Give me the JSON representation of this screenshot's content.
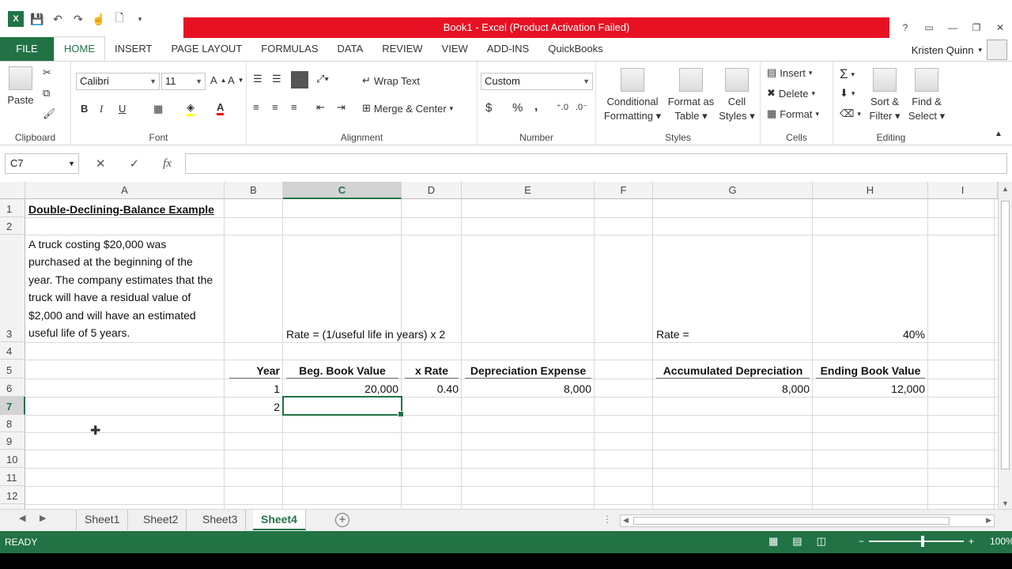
{
  "app": {
    "title": "Book1 -  Excel (Product Activation Failed)",
    "logo": "X",
    "help": "?",
    "window_controls": [
      "▭",
      "—",
      "❐",
      "✕"
    ]
  },
  "tabs": [
    "FILE",
    "HOME",
    "INSERT",
    "PAGE LAYOUT",
    "FORMULAS",
    "DATA",
    "REVIEW",
    "VIEW",
    "ADD-INS",
    "QuickBooks"
  ],
  "active_tab": "HOME",
  "user": {
    "name": "Kristen Quinn"
  },
  "ribbon": {
    "clipboard": {
      "paste": "Paste",
      "label": "Clipboard"
    },
    "font": {
      "name": "Calibri",
      "size": "11",
      "bold": "B",
      "italic": "I",
      "underline": "U",
      "label": "Font"
    },
    "alignment": {
      "wrap_text": "Wrap Text",
      "merge_center": "Merge & Center",
      "label": "Alignment"
    },
    "number": {
      "format": "Custom",
      "currency": "$",
      "percent": "%",
      "comma": ",",
      "label": "Number"
    },
    "styles": {
      "conditional": "Conditional",
      "conditional2": "Formatting",
      "format_as": "Format as",
      "format_as2": "Table",
      "cell": "Cell",
      "cell2": "Styles",
      "label": "Styles"
    },
    "cells": {
      "insert": "Insert",
      "delete": "Delete",
      "format": "Format",
      "label": "Cells"
    },
    "editing": {
      "sort": "Sort &",
      "sort2": "Filter",
      "find": "Find &",
      "find2": "Select",
      "label": "Editing"
    }
  },
  "formula_bar": {
    "name_box": "C7",
    "cancel": "✕",
    "enter": "✓",
    "fx": "fx",
    "value": ""
  },
  "columns": [
    "A",
    "B",
    "C",
    "D",
    "E",
    "F",
    "G",
    "H",
    "I"
  ],
  "selected_column": "C",
  "rows": [
    "1",
    "2",
    "3",
    "4",
    "5",
    "6",
    "7",
    "8",
    "9",
    "10",
    "11",
    "12"
  ],
  "selected_row": "7",
  "cells": {
    "A1": "Double-Declining-Balance Example",
    "A3": "A truck costing $20,000 was purchased at the beginning of the year.  The company estimates that the truck will have a residual value of $2,000 and will have an estimated useful life of 5 years.",
    "C3": "Rate = (1/useful life in years) x 2",
    "G3": "Rate =",
    "H3": "40%",
    "B5": "Year",
    "C5": "Beg. Book Value",
    "D5": "x Rate",
    "E5": "Depreciation Expense",
    "G5": "Accumulated Depreciation",
    "H5": "Ending Book Value",
    "B6": "1",
    "C6": "20,000",
    "D6": "0.40",
    "E6": "8,000",
    "G6": "8,000",
    "H6": "12,000",
    "B7": "2"
  },
  "sheets": [
    "Sheet1",
    "Sheet2",
    "Sheet3",
    "Sheet4"
  ],
  "active_sheet": "Sheet4",
  "status": {
    "mode": "READY",
    "zoom": "100%"
  }
}
